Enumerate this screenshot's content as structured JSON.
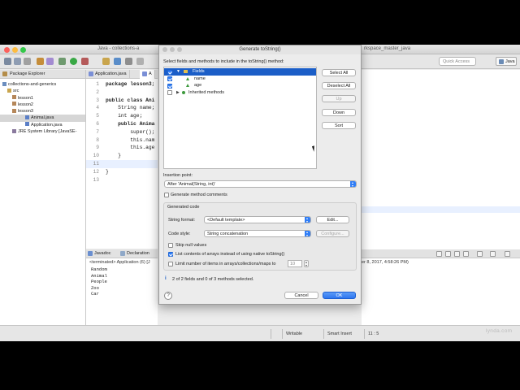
{
  "window": {
    "title_left": "Java - collections-a",
    "title_center": "Generate toString()",
    "title_right": "rkspace_master_java"
  },
  "toolbar": {
    "quick_access": "Quick Access",
    "perspective": "Java"
  },
  "package_explorer": {
    "tab_label": "Package Explorer",
    "items": [
      {
        "label": "collections-and-generics"
      },
      {
        "label": "src"
      },
      {
        "label": "lesson1"
      },
      {
        "label": "lesson2"
      },
      {
        "label": "lesson3"
      },
      {
        "label": "Animal.java"
      },
      {
        "label": "Application.java"
      },
      {
        "label": "JRE System Library [JavaSE-"
      }
    ]
  },
  "editor": {
    "tabs": [
      "Application.java",
      "A"
    ],
    "lines": [
      {
        "num": "1",
        "code": "package lesson3;"
      },
      {
        "num": "2",
        "code": ""
      },
      {
        "num": "3",
        "code": "public class Ani"
      },
      {
        "num": "4",
        "code": "    String name;"
      },
      {
        "num": "5",
        "code": "    int age;"
      },
      {
        "num": "6",
        "code": "    public Anima"
      },
      {
        "num": "7",
        "code": "        super();"
      },
      {
        "num": "8",
        "code": "        this.nam"
      },
      {
        "num": "9",
        "code": "        this.age"
      },
      {
        "num": "10",
        "code": "    }"
      },
      {
        "num": "11",
        "code": ""
      },
      {
        "num": "12",
        "code": "}"
      },
      {
        "num": "13",
        "code": ""
      }
    ]
  },
  "console": {
    "tabs": [
      "Javadoc",
      "Declaration"
    ],
    "header": "<terminated> Application (6) [J",
    "lines": [
      "Random",
      "Animal",
      "People",
      "Zoo",
      "Car"
    ],
    "timestamp": "er 8, 2017, 4:58:26 PM)"
  },
  "statusbar": {
    "writable": "Writable",
    "insert_mode": "Smart Insert",
    "position": "11 : 5",
    "watermark": "lynda.com"
  },
  "dialog": {
    "title": "Generate toString()",
    "instruction": "Select fields and methods to include in the toString() method:",
    "tree": [
      {
        "label": "Fields",
        "checked": true,
        "selected": true
      },
      {
        "label": "name",
        "checked": true
      },
      {
        "label": "age",
        "checked": true
      },
      {
        "label": "Inherited methods",
        "checked": false
      }
    ],
    "side_buttons": {
      "select_all": "Select All",
      "deselect_all": "Deselect All",
      "up": "Up",
      "down": "Down",
      "sort": "Sort"
    },
    "insertion_point_label": "Insertion point:",
    "insertion_point_value": "After 'Animal(String, int)'",
    "generate_comments_label": "Generate method comments",
    "generated_code_label": "Generated code",
    "string_format_label": "String format:",
    "string_format_value": "<Default template>",
    "edit_button": "Edit...",
    "code_style_label": "Code style:",
    "code_style_value": "String concatenation",
    "configure_button": "Configure...",
    "skip_null_label": "Skip null values",
    "list_contents_label": "List contents of arrays instead of using native toString()",
    "limit_label": "Limit number of items in arrays/collections/maps to",
    "limit_value": "10",
    "status_text": "2 of 2 fields and 0 of 3 methods selected.",
    "cancel_button": "Cancel",
    "ok_button": "OK"
  }
}
